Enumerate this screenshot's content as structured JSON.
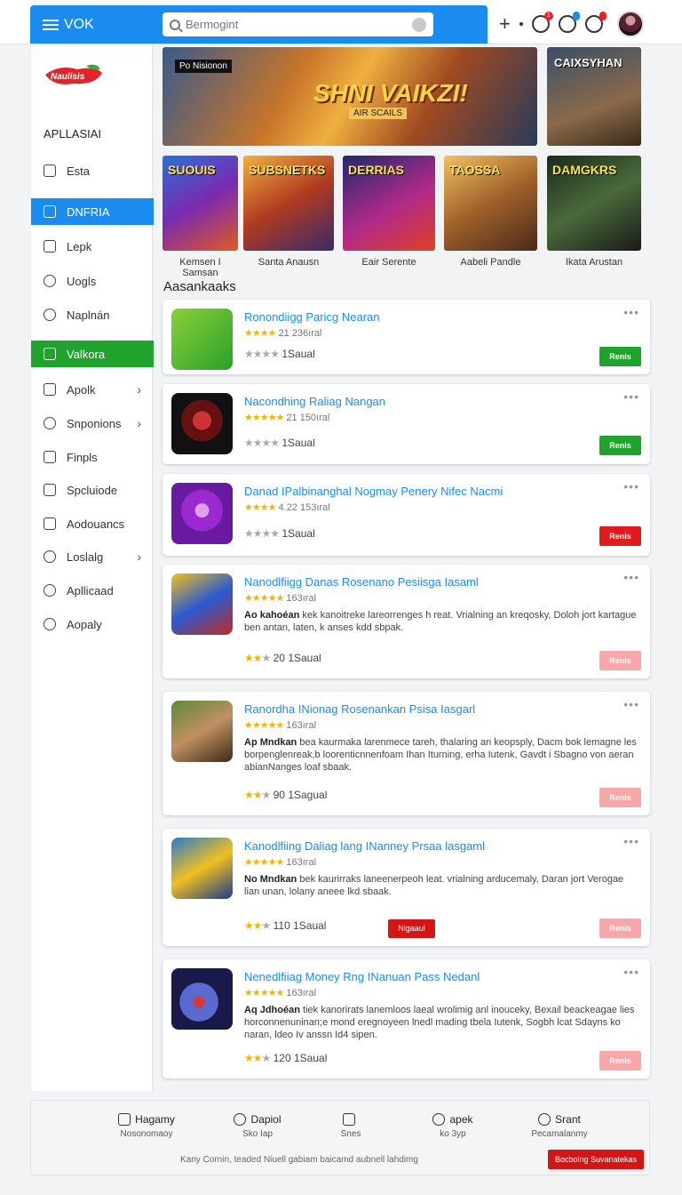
{
  "header": {
    "title": "VOK",
    "search_placeholder": "Bermogint",
    "notifications": [
      {
        "icon": "globe-icon",
        "badge": "1"
      },
      {
        "icon": "link-icon",
        "badge": ""
      },
      {
        "icon": "bag-icon",
        "badge": ""
      }
    ]
  },
  "sidebar": {
    "logo": "Naulisis",
    "heading": "APLLASIAI",
    "items": [
      {
        "label": "Esta",
        "icon": "box-icon"
      },
      {
        "label": "DNFRIA",
        "icon": "grid-icon"
      },
      {
        "label": "Lepk",
        "icon": "page-icon"
      },
      {
        "label": "Uogls",
        "icon": "compass-icon"
      },
      {
        "label": "Naplnán",
        "icon": "compass-icon"
      },
      {
        "label": "Valkora",
        "icon": "tools-icon"
      },
      {
        "label": "Apolk",
        "icon": "shield-icon"
      },
      {
        "label": "Snponions",
        "icon": "search-icon"
      },
      {
        "label": "Finpls",
        "icon": "finger-icon"
      },
      {
        "label": "Spcluiode",
        "icon": "lock-icon"
      },
      {
        "label": "Aodouancs",
        "icon": "grid-icon"
      },
      {
        "label": "Loslalg",
        "icon": "gear-icon"
      },
      {
        "label": "Apllicaad",
        "icon": "info-icon"
      },
      {
        "label": "Aopaly",
        "icon": "clock-icon"
      }
    ]
  },
  "banners": {
    "main_tag": "Po Nisionon",
    "main_title": "SHNI VAIKZI!",
    "main_subtitle": "AIR SCAILS",
    "side_title": "CAIXSYHAN"
  },
  "featured": [
    {
      "art": "SUOUIS",
      "caption": "Kemsen I Samsan"
    },
    {
      "art": "SUBSNETKS",
      "caption": "Santa Anausn"
    },
    {
      "art": "DERRIAS",
      "caption": "Eair Serente"
    },
    {
      "art": "TAOSSA",
      "caption": "Aabeli Pandle"
    },
    {
      "art": "DAMGKRS",
      "caption": "Ikata Arustan"
    }
  ],
  "section_title": "Aasankaaks",
  "apps": [
    {
      "title": "Ronondiigg Paricg Nearan",
      "rating_line": "21  236ıral",
      "desc_bold": "",
      "desc": "",
      "rating2": "1Saual",
      "rating2_prefix": "",
      "button": "Renis",
      "mid_button": ""
    },
    {
      "title": "Nacondhing Raliag Nangan",
      "rating_line": "21 150ıral",
      "desc_bold": "",
      "desc": "",
      "rating2": "1Saual",
      "rating2_prefix": "",
      "button": "Renis",
      "mid_button": ""
    },
    {
      "title": "Danad IPalbinanghal Nogmay Penery Nifec Nacmi",
      "rating_line": "4.22 153ıral",
      "desc_bold": "",
      "desc": "",
      "rating2": "1Saual",
      "rating2_prefix": "",
      "button": "Renis",
      "mid_button": ""
    },
    {
      "title": "Nanodlfiigg Danas Rosenano Pesiisga Iasaml",
      "rating_line": "163ıral",
      "desc_bold": "Ao kahoéan",
      "desc": "kek kanoitreke lareorrenges h reat. Vrialning an kreqosky, Doloh jort kartague ben antan, laten, k anses kdd sbpak.",
      "rating2": "1Saual",
      "rating2_prefix": "20",
      "button": "Renis",
      "mid_button": ""
    },
    {
      "title": "Ranordha INionag Rosenankan Psisa Iasgarl",
      "rating_line": "163ıral",
      "desc_bold": "Ap Mndkan",
      "desc": "bea kaurmaka larenmece tareh, thalaring an keopsply, Dacm bok lemagne les borpenglenreak,b loorenticnnenfoam Ihan Iturning, erha Iutenk, Gavdt i Sbagno von aeran abianNanges loaf sbaak.",
      "rating2": "1Sagual",
      "rating2_prefix": "90",
      "button": "Renis",
      "mid_button": ""
    },
    {
      "title": "Kanodlfiing Daliag lang INanney Prsaa lasgaml",
      "rating_line": "163ıral",
      "desc_bold": "No Mndkan",
      "desc": "bek kaurirraks laneenerpeoh leat. vrialning arducemaly, Daran jort Verogae lian unan, lolany aneee lkd sbaak.",
      "rating2": "1Saual",
      "rating2_prefix": "110",
      "button": "Renis",
      "mid_button": "Nigaaul"
    },
    {
      "title": "Nenedlfiiag Money Rng INanuan Pass Nedanl",
      "rating_line": "163ıral",
      "desc_bold": "Aq Jdhoéan",
      "desc": "tiek kanorirats lanemloos laeal wrolimig anl inouceky, Bexail beackeagae lies horconnenuninan;e mond eregnoyeen lnedl mading tbela Iutenk, Sogbh lcat Sdayns ko naran, ldeo Iv anssn Id4 sipen.",
      "rating2": "1Saual",
      "rating2_prefix": "120",
      "button": "Renis",
      "mid_button": ""
    }
  ],
  "footer": {
    "columns": [
      {
        "head": "Hagamy",
        "sub": "Nosonomaoy",
        "icon": "calendar-icon"
      },
      {
        "head": "Dapiol",
        "sub": "Sko  Iap",
        "icon": "clock-icon"
      },
      {
        "head": "",
        "sub": "Snes",
        "icon": "document-icon"
      },
      {
        "head": "apek",
        "sub": "ko  3yp",
        "icon": "pen-icon"
      },
      {
        "head": "Srant",
        "sub": "Pecamalanmy",
        "icon": "globe-icon"
      }
    ],
    "copyright": "Kany Cornin, teaded Niuell gabiam baicamd aubnell lahdimg",
    "cta": "Bocbolng Suvanatekas"
  },
  "colors": {
    "accent": "#1a8cf0",
    "green": "#1fa32c",
    "red": "#e11b1b",
    "link": "#1a8cf0"
  }
}
